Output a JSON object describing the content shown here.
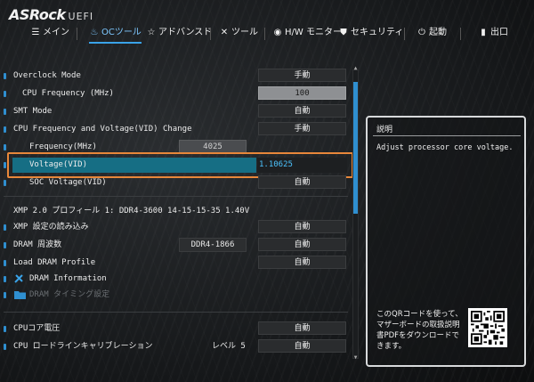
{
  "brand": {
    "name": "ASRock",
    "suffix": "UEFI"
  },
  "nav": [
    {
      "icon": "list-icon",
      "glyph": "☰",
      "label": "メイン",
      "active": false
    },
    {
      "icon": "flame-icon",
      "glyph": "♨",
      "label": "OCツール",
      "active": true
    },
    {
      "icon": "star-icon",
      "glyph": "☆",
      "label": "アドバンスド",
      "active": false
    },
    {
      "icon": "tools-icon",
      "glyph": "✕",
      "label": "ツール",
      "active": false
    },
    {
      "icon": "monitor-icon",
      "glyph": "◉",
      "label": "H/W モニター",
      "active": false
    },
    {
      "icon": "shield-icon",
      "glyph": "⛊",
      "label": "セキュリティ",
      "active": false
    },
    {
      "icon": "power-icon",
      "glyph": "⏻",
      "label": "起動",
      "active": false
    },
    {
      "icon": "exit-icon",
      "glyph": "▮",
      "label": "出口",
      "active": false
    }
  ],
  "rows": {
    "overclock_mode": {
      "label": "Overclock Mode",
      "value": "手動"
    },
    "cpu_frequency": {
      "label": "CPU Frequency (MHz)",
      "value": "100"
    },
    "smt_mode": {
      "label": "SMT Mode",
      "value": "自動"
    },
    "cpu_freq_voltage_change": {
      "label": "CPU Frequency and Voltage(VID) Change",
      "value": "手動"
    },
    "frequency_mhz": {
      "label": "Frequency(MHz)",
      "value": "4025"
    },
    "voltage_vid": {
      "label": "Voltage(VID)",
      "value": "1.10625"
    },
    "soc_voltage": {
      "label": "SOC Voltage(VID)",
      "value": "自動"
    },
    "xmp_profile": {
      "label": "XMP 2.0 プロフィール 1: DDR4-3600 14-15-15-35 1.40V"
    },
    "xmp_load": {
      "label": "XMP 設定の読み込み",
      "value": "自動"
    },
    "dram_freq": {
      "label": "DRAM 周波数",
      "mid": "DDR4-1866",
      "value": "自動"
    },
    "load_dram_profile": {
      "label": "Load DRAM Profile",
      "value": "自動"
    },
    "dram_information": {
      "label": "DRAM Information"
    },
    "dram_timing": {
      "label": "DRAM タイミング設定"
    },
    "cpu_core_voltage": {
      "label": "CPUコア電圧",
      "value": "自動"
    },
    "cpu_llc": {
      "label": "CPU ロードラインキャリブレーション",
      "mid": "レベル 5",
      "value": "自動"
    }
  },
  "description": {
    "title": "説明",
    "text": "Adjust processor core voltage.",
    "qr_text": "このQRコードを使って、マザーボードの取扱説明書PDFをダウンロードできます。"
  },
  "colors": {
    "accent": "#2f8fd0",
    "selected_row": "#166e84",
    "highlight_border": "#e8873a",
    "selected_value": "#4cc4ff"
  }
}
